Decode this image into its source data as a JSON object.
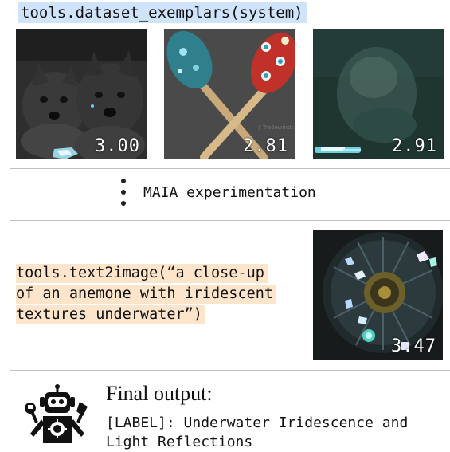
{
  "header": {
    "call": "tools.dataset_exemplars(system)"
  },
  "exemplars": [
    {
      "score": "3.00",
      "subject": "dogs"
    },
    {
      "score": "2.81",
      "subject": "maracas"
    },
    {
      "score": "2.91",
      "subject": "beluga"
    }
  ],
  "experiment": {
    "label": "MAIA experimentation"
  },
  "text2image": {
    "lines": [
      "tools.text2image(“a close-up",
      "of an anemone with iridescent",
      "textures underwater”)"
    ],
    "score": "3.47"
  },
  "final": {
    "title": "Final output:",
    "label_lines": [
      "[LABEL]: Underwater Iridescence and",
      "Light Reflections"
    ]
  },
  "colors": {
    "blue_highlight": "#cfe4fb",
    "orange_highlight": "#fde5cc",
    "divider": "#bfbfbf"
  },
  "icons": [
    "robot-icon"
  ]
}
